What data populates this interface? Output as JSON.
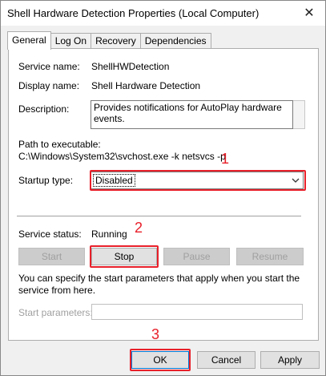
{
  "window": {
    "title": "Shell Hardware Detection Properties (Local Computer)",
    "close_glyph": "✕"
  },
  "tabs": [
    "General",
    "Log On",
    "Recovery",
    "Dependencies"
  ],
  "general": {
    "service_name_label": "Service name:",
    "service_name_value": "ShellHWDetection",
    "display_name_label": "Display name:",
    "display_name_value": "Shell Hardware Detection",
    "description_label": "Description:",
    "description_value": "Provides notifications for AutoPlay hardware events.",
    "path_label": "Path to executable:",
    "path_value": "C:\\Windows\\System32\\svchost.exe -k netsvcs -p",
    "startup_type_label": "Startup type:",
    "startup_type_value": "Disabled",
    "service_status_label": "Service status:",
    "service_status_value": "Running",
    "buttons": {
      "start": "Start",
      "stop": "Stop",
      "pause": "Pause",
      "resume": "Resume"
    },
    "help_text": "You can specify the start parameters that apply when you start the service from here.",
    "start_params_label": "Start parameters:",
    "start_params_value": ""
  },
  "footer": {
    "ok": "OK",
    "cancel": "Cancel",
    "apply": "Apply"
  },
  "annotations": [
    "1",
    "2",
    "3"
  ],
  "colors": {
    "highlight": "#e8202a",
    "focus_border": "#0078d7"
  }
}
